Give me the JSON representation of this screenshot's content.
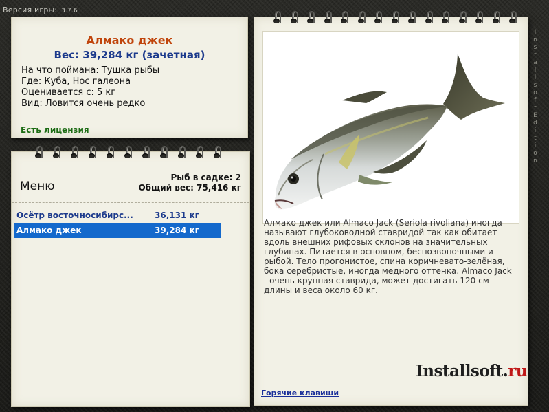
{
  "version": {
    "label": "Версия игры:",
    "number": "3.7.6"
  },
  "info": {
    "fish_name": "Алмако джек",
    "weight": "Вес: 39,284 кг (зачетная)",
    "lines": [
      "На что поймана: Тушка рыбы",
      "Где: Куба, Нос галеона",
      "Оценивается с: 5 кг",
      "Вид: Ловится очень редко"
    ],
    "license": "Есть лицензия"
  },
  "menu": {
    "title": "Меню",
    "caught_count": "Рыб в садке: 2",
    "total_weight": "Общий вес: 75,416 кг",
    "rows": [
      {
        "name": "Осётр восточносибирс...",
        "weight": "36,131 кг",
        "selected": false
      },
      {
        "name": "Алмако джек",
        "weight": "39,284 кг",
        "selected": true
      }
    ]
  },
  "detail": {
    "description": "Алмако джек или Almaco Jack (Seriola rivoliana) иногда называют глубоководной ставридой так как обитает вдоль внешних рифовых склонов на значительных глубинах. Питается в основном, беспозвоночными и рыбой. Тело прогонистое, спина коричневато-зелёная, бока серебристые, иногда медного оттенка. Almaco Jack - очень крупная ставрида, может достигать 120 см длины и веса около 60 кг.",
    "logo_main": "Installsoft.",
    "logo_tld": "ru",
    "hotkeys": "Горячие клавиши"
  },
  "side_brand": "Installsoft Edition",
  "colors": {
    "accent_selected": "#1469cc",
    "title": "#c0450c",
    "weight": "#1c3a8c",
    "license": "#1b6b13"
  }
}
